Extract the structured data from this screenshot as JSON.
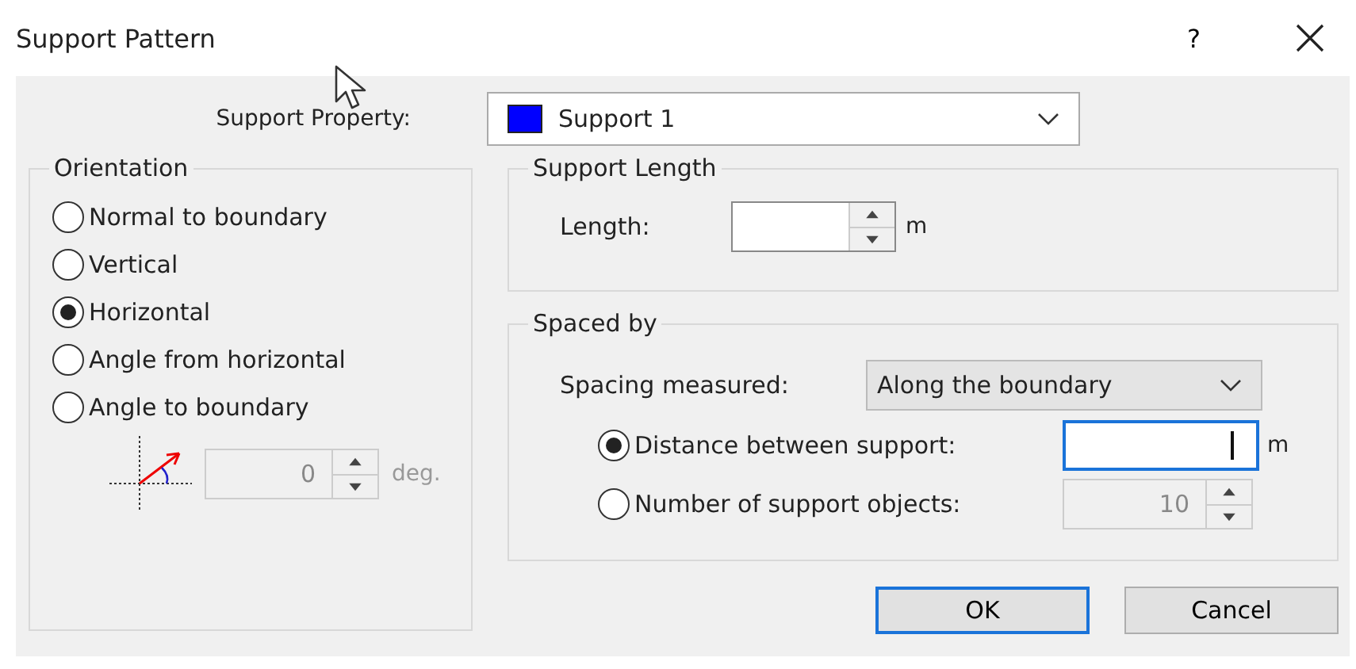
{
  "window": {
    "title": "Support Pattern",
    "help": "?"
  },
  "support_property": {
    "label": "Support Property:",
    "value": "Support 1",
    "color": "#0000ff"
  },
  "orientation": {
    "title": "Orientation",
    "options": [
      {
        "label": "Normal to boundary",
        "selected": false
      },
      {
        "label": "Vertical",
        "selected": false
      },
      {
        "label": "Horizontal",
        "selected": true
      },
      {
        "label": "Angle from horizontal",
        "selected": false
      },
      {
        "label": "Angle to boundary",
        "selected": false
      }
    ],
    "angle": {
      "value": "0",
      "unit": "deg.",
      "disabled": true
    }
  },
  "support_length": {
    "title": "Support Length",
    "label": "Length:",
    "unit": "m"
  },
  "spaced_by": {
    "title": "Spaced by",
    "spacing_label": "Spacing measured:",
    "spacing_value": "Along the boundary",
    "options": [
      {
        "label": "Distance between support:",
        "selected": true,
        "kind": "text",
        "unit": "m",
        "focused": true
      },
      {
        "label": "Number of support objects:",
        "selected": false,
        "kind": "spin",
        "value": "10",
        "disabled": true
      }
    ]
  },
  "buttons": [
    {
      "label": "OK",
      "default": true
    },
    {
      "label": "Cancel",
      "default": false
    }
  ]
}
